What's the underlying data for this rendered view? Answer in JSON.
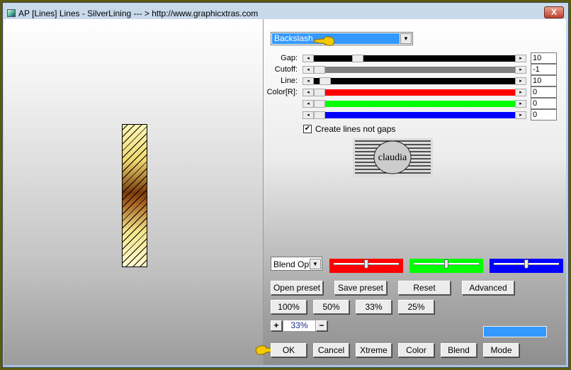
{
  "window": {
    "title": "AP [Lines]  Lines - SilverLining    --- > http://www.graphicxtras.com",
    "close_label": "X"
  },
  "pattern_select": {
    "value": "Backslash"
  },
  "sliders": [
    {
      "label": "Gap:",
      "value": "10",
      "color": "#000000",
      "fraction": 0.2
    },
    {
      "label": "Cutoff:",
      "value": "-1",
      "color": "#808080",
      "fraction": 0.0
    },
    {
      "label": "Line:",
      "value": "10",
      "color": "#000000",
      "fraction": 0.03
    },
    {
      "label": "Color[R]:",
      "value": "0",
      "color": "#ff0000",
      "fraction": 0.0
    },
    {
      "label": "",
      "value": "0",
      "color": "#00ff00",
      "fraction": 0.0
    },
    {
      "label": "",
      "value": "0",
      "color": "#0000ff",
      "fraction": 0.0
    }
  ],
  "checkbox": {
    "label": "Create lines not gaps",
    "checked": true
  },
  "logo": {
    "text": "claudia"
  },
  "blend_select": {
    "value": "Blend Optio"
  },
  "blend_sliders": [
    {
      "color": "#ff0000",
      "fraction": 0.5
    },
    {
      "color": "#00ff00",
      "fraction": 0.5
    },
    {
      "color": "#0000ff",
      "fraction": 0.5
    }
  ],
  "buttons": {
    "open_preset": "Open preset",
    "save_preset": "Save preset",
    "reset": "Reset",
    "advanced": "Advanced",
    "z100": "100%",
    "z50": "50%",
    "z33": "33%",
    "z25": "25%",
    "ok": "OK",
    "cancel": "Cancel",
    "xtreme": "Xtreme",
    "color": "Color",
    "blend": "Blend",
    "mode": "Mode"
  },
  "zoom": {
    "plus": "+",
    "value": "33%",
    "minus": "−"
  },
  "swatch_color": "#3399ff"
}
